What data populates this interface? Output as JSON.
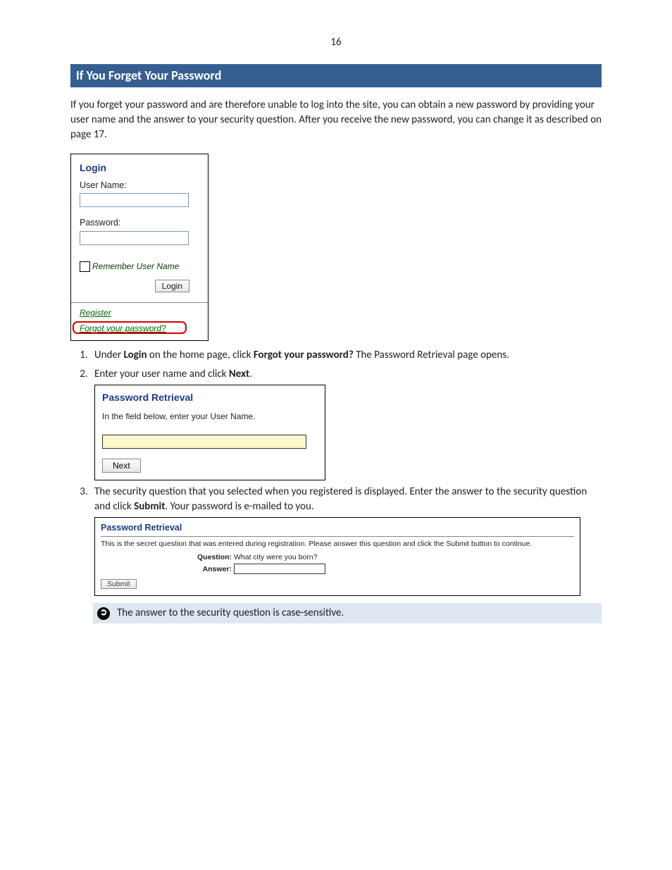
{
  "page_number": "16",
  "heading": "If You Forget Your Password",
  "intro": "If you forget your password and are therefore unable to log into the site, you can obtain a new password by providing your user name and the answer to your security question. After you receive the new password, you can change it as described on page 17.",
  "login_panel": {
    "title": "Login",
    "username_label": "User Name:",
    "password_label": "Password:",
    "remember_label": "Remember User Name",
    "login_button": "Login",
    "register_link": "Register",
    "forgot_link": "Forgot your password?"
  },
  "steps": {
    "s1": {
      "pre": "Under ",
      "b1": "Login",
      "mid": " on the home page, click ",
      "b2": "Forgot your password?",
      "post": " The Password Retrieval page opens."
    },
    "s2": {
      "pre": "Enter your user name and click ",
      "b1": "Next",
      "post": "."
    },
    "s3": {
      "pre": "The security question that you selected when you registered is displayed. Enter the answer to the security question and click ",
      "b1": "Submit",
      "post": ". Your password is e-mailed to you."
    }
  },
  "panel2": {
    "title": "Password Retrieval",
    "instr": "In the field below, enter your User Name.",
    "next_button": "Next"
  },
  "panel3": {
    "title": "Password Retrieval",
    "instr": "This is the secret question that was entered during registration. Please answer this question and click the Submit button to continue.",
    "question_label": "Question:",
    "question_text": "What city were you born?",
    "answer_label": "Answer:",
    "submit_button": "Submit"
  },
  "note": "The answer to the security question is case-sensitive."
}
